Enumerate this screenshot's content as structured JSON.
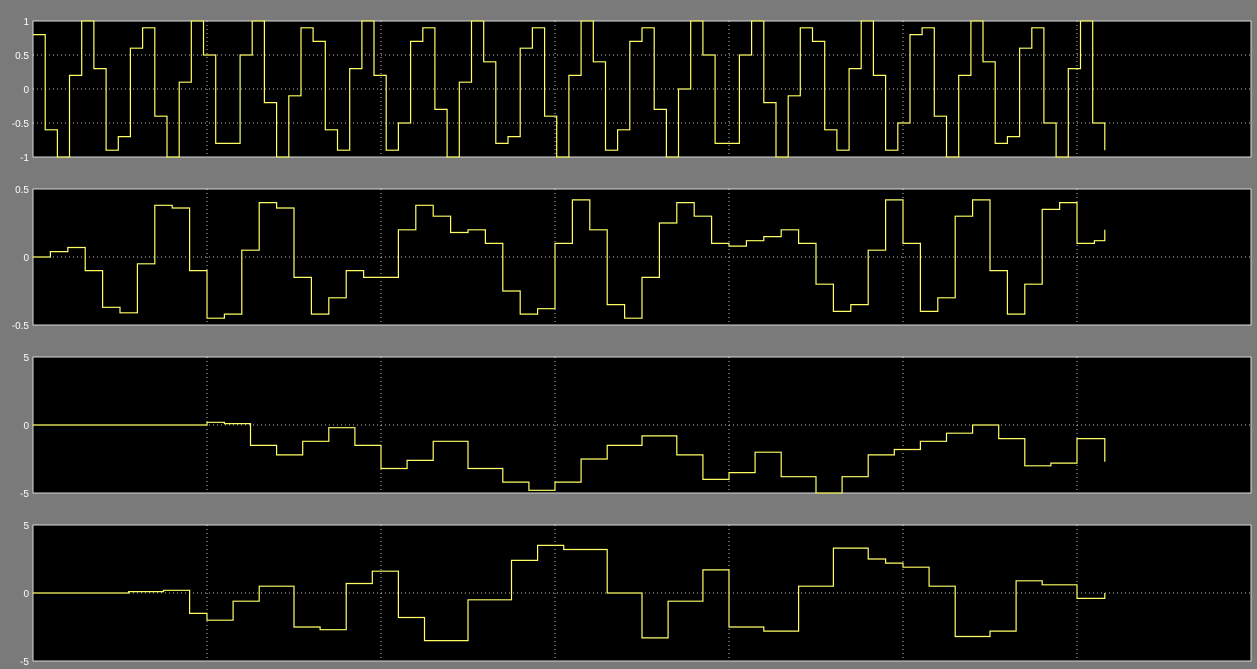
{
  "window": {
    "background": "#7a7a7a"
  },
  "chart_data": [
    {
      "type": "line",
      "step": true,
      "ylim": [
        -1,
        1
      ],
      "yticks": [
        "1",
        "0.5",
        "0",
        "-0.5",
        "-1"
      ],
      "grid": true,
      "colors": {
        "background": "#000000",
        "trace": "#ffff66",
        "grid": "#ffffff"
      },
      "series": [
        {
          "x": [
            0,
            0.07,
            0.14,
            0.21,
            0.28,
            0.35,
            0.42,
            0.49,
            0.56,
            0.63,
            0.7,
            0.77,
            0.84,
            0.91,
            0.98,
            1.05,
            1.12,
            1.19,
            1.26,
            1.33,
            1.4,
            1.47,
            1.54,
            1.61,
            1.68,
            1.75,
            1.82,
            1.89,
            1.96,
            2.03,
            2.1,
            2.17,
            2.24,
            2.31,
            2.38,
            2.45,
            2.52,
            2.59,
            2.66,
            2.73,
            2.8,
            2.87,
            2.94,
            3.01,
            3.08,
            3.15,
            3.22,
            3.29,
            3.36,
            3.43,
            3.5,
            3.57,
            3.64,
            3.71,
            3.78,
            3.85,
            3.92,
            3.99,
            4.06,
            4.13,
            4.2,
            4.27,
            4.34,
            4.41,
            4.48,
            4.55,
            4.62,
            4.69,
            4.76,
            4.83,
            4.9,
            4.97,
            5.04,
            5.11,
            5.18,
            5.25,
            5.32,
            5.39,
            5.46,
            5.53,
            5.6,
            5.67,
            5.74,
            5.81,
            5.88,
            5.95,
            6.02,
            6.09,
            6.16
          ],
          "y": [
            0.8,
            -0.6,
            -1,
            0.2,
            1,
            0.3,
            -0.9,
            -0.7,
            0.6,
            0.9,
            -0.4,
            -1,
            0.1,
            1,
            0.5,
            -0.8,
            -0.8,
            0.5,
            1,
            -0.2,
            -1,
            -0.1,
            0.9,
            0.7,
            -0.6,
            -0.9,
            0.3,
            1,
            0.2,
            -0.9,
            -0.5,
            0.7,
            0.9,
            -0.3,
            -1,
            0.1,
            1,
            0.4,
            -0.8,
            -0.7,
            0.6,
            0.9,
            -0.4,
            -1,
            0.2,
            1,
            0.4,
            -0.9,
            -0.6,
            0.7,
            0.9,
            -0.3,
            -1,
            0,
            1,
            0.5,
            -0.8,
            -0.8,
            0.5,
            1,
            -0.2,
            -1,
            -0.1,
            0.9,
            0.7,
            -0.6,
            -0.9,
            0.3,
            1,
            0.2,
            -0.9,
            -0.5,
            0.8,
            0.9,
            -0.4,
            -1,
            0.2,
            1,
            0.4,
            -0.8,
            -0.7,
            0.6,
            0.9,
            -0.5,
            -1,
            0.3,
            1,
            -0.5,
            -0.9
          ]
        }
      ]
    },
    {
      "type": "line",
      "step": true,
      "ylim": [
        -0.5,
        0.5
      ],
      "yticks": [
        "0.5",
        "0",
        "-0.5"
      ],
      "grid": true,
      "colors": {
        "background": "#000000",
        "trace": "#ffff66",
        "grid": "#ffffff"
      },
      "series": [
        {
          "x": [
            0,
            0.1,
            0.2,
            0.3,
            0.4,
            0.5,
            0.6,
            0.7,
            0.8,
            0.9,
            1.0,
            1.1,
            1.2,
            1.3,
            1.4,
            1.5,
            1.6,
            1.7,
            1.8,
            1.9,
            2.0,
            2.1,
            2.2,
            2.3,
            2.4,
            2.5,
            2.6,
            2.7,
            2.8,
            2.9,
            3.0,
            3.1,
            3.2,
            3.3,
            3.4,
            3.5,
            3.6,
            3.7,
            3.8,
            3.9,
            4.0,
            4.1,
            4.2,
            4.3,
            4.4,
            4.5,
            4.6,
            4.7,
            4.8,
            4.9,
            5.0,
            5.1,
            5.2,
            5.3,
            5.4,
            5.5,
            5.6,
            5.7,
            5.8,
            5.9,
            6.0,
            6.1,
            6.16
          ],
          "y": [
            0,
            0.04,
            0.07,
            -0.1,
            -0.37,
            -0.41,
            -0.05,
            0.38,
            0.36,
            -0.1,
            -0.45,
            -0.42,
            0.05,
            0.4,
            0.36,
            -0.15,
            -0.42,
            -0.3,
            -0.1,
            -0.15,
            -0.15,
            0.2,
            0.38,
            0.3,
            0.18,
            0.2,
            0.1,
            -0.25,
            -0.42,
            -0.38,
            0.1,
            0.42,
            0.2,
            -0.35,
            -0.45,
            -0.15,
            0.25,
            0.4,
            0.3,
            0.1,
            0.08,
            0.12,
            0.15,
            0.2,
            0.1,
            -0.2,
            -0.4,
            -0.35,
            0.05,
            0.42,
            0.1,
            -0.4,
            -0.3,
            0.3,
            0.42,
            -0.1,
            -0.42,
            -0.2,
            0.35,
            0.4,
            0.1,
            0.12,
            0.2
          ]
        }
      ]
    },
    {
      "type": "line",
      "step": true,
      "ylim": [
        -5,
        5
      ],
      "yticks": [
        "5",
        "0",
        "-5"
      ],
      "grid": true,
      "colors": {
        "background": "#000000",
        "trace": "#ffff66",
        "grid": "#ffffff"
      },
      "series": [
        {
          "x": [
            0,
            0.5,
            0.8,
            0.9,
            1.0,
            1.1,
            1.25,
            1.4,
            1.55,
            1.7,
            1.85,
            2.0,
            2.15,
            2.3,
            2.5,
            2.7,
            2.85,
            3.0,
            3.15,
            3.3,
            3.5,
            3.7,
            3.85,
            4.0,
            4.15,
            4.3,
            4.5,
            4.65,
            4.8,
            4.95,
            5.1,
            5.25,
            5.4,
            5.55,
            5.7,
            5.85,
            6.0,
            6.16
          ],
          "y": [
            0,
            0,
            0,
            0,
            0.2,
            0.1,
            -1.5,
            -2.2,
            -1.2,
            -0.2,
            -1.5,
            -3.2,
            -2.6,
            -1.2,
            -3.2,
            -4.2,
            -4.8,
            -4.2,
            -2.5,
            -1.5,
            -0.8,
            -2.2,
            -4.0,
            -3.5,
            -2.0,
            -3.8,
            -5.0,
            -3.8,
            -2.2,
            -1.8,
            -1.2,
            -0.6,
            0.0,
            -1.0,
            -3.0,
            -2.8,
            -1.0,
            -2.7
          ]
        }
      ]
    },
    {
      "type": "line",
      "step": true,
      "ylim": [
        -5,
        5
      ],
      "yticks": [
        "5",
        "0",
        "-5"
      ],
      "grid": true,
      "colors": {
        "background": "#000000",
        "trace": "#ffff66",
        "grid": "#ffffff"
      },
      "series": [
        {
          "x": [
            0,
            0.4,
            0.55,
            0.75,
            0.9,
            1.0,
            1.15,
            1.3,
            1.5,
            1.65,
            1.8,
            1.95,
            2.1,
            2.25,
            2.5,
            2.75,
            2.9,
            3.05,
            3.3,
            3.5,
            3.65,
            3.85,
            4.0,
            4.2,
            4.4,
            4.6,
            4.8,
            4.9,
            5.0,
            5.15,
            5.3,
            5.5,
            5.65,
            5.8,
            6.0,
            6.16
          ],
          "y": [
            0,
            0,
            0.1,
            0.2,
            -1.5,
            -2.0,
            -0.6,
            0.5,
            -2.5,
            -2.7,
            0.7,
            1.6,
            -1.8,
            -3.5,
            -0.5,
            2.4,
            3.5,
            3.2,
            0,
            -3.3,
            -0.6,
            1.7,
            -2.5,
            -2.8,
            0.5,
            3.3,
            2.5,
            2.2,
            1.9,
            0.5,
            -3.2,
            -2.8,
            0.9,
            0.6,
            -0.4,
            0
          ]
        }
      ]
    }
  ],
  "x_axis": {
    "xlim": [
      0,
      7
    ]
  }
}
